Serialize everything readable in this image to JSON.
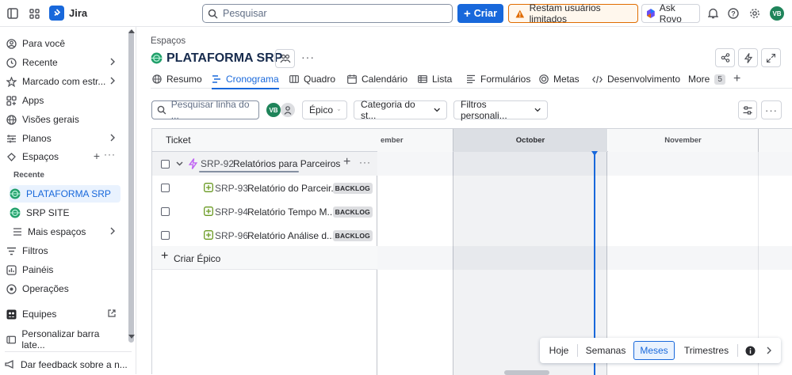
{
  "topbar": {
    "app_name": "Jira",
    "search_placeholder": "Pesquisar",
    "create_label": "Criar",
    "warning_label": "Restam usuários limitados",
    "rovo_label": "Ask Rovo",
    "avatar_initials": "VB"
  },
  "sidebar": {
    "items": [
      {
        "label": "Para você"
      },
      {
        "label": "Recente"
      },
      {
        "label": "Marcado com estr..."
      },
      {
        "label": "Apps"
      },
      {
        "label": "Visões gerais"
      },
      {
        "label": "Planos"
      },
      {
        "label": "Espaços"
      }
    ],
    "recent_heading": "Recente",
    "spaces": [
      {
        "label": "PLATAFORMA SRP"
      },
      {
        "label": "SRP SITE"
      },
      {
        "label": "Mais espaços"
      }
    ],
    "bottom_items": [
      {
        "label": "Filtros"
      },
      {
        "label": "Painéis"
      },
      {
        "label": "Operações"
      },
      {
        "label": "Equipes"
      },
      {
        "label": "Personalizar barra late..."
      },
      {
        "label": "Dar feedback sobre a n..."
      }
    ]
  },
  "header": {
    "breadcrumb": "Espaços",
    "title": "PLATAFORMA SRP"
  },
  "tabs": [
    {
      "label": "Resumo"
    },
    {
      "label": "Cronograma"
    },
    {
      "label": "Quadro"
    },
    {
      "label": "Calendário"
    },
    {
      "label": "Lista"
    },
    {
      "label": "Formulários"
    },
    {
      "label": "Metas"
    },
    {
      "label": "Desenvolvimento"
    },
    {
      "label": "More"
    }
  ],
  "more_count": "5",
  "toolbar": {
    "search_placeholder": "Pesquisar linha do ...",
    "avatar_initials": "VB",
    "epic_filter": "Épico",
    "category_filter": "Categoria do st...",
    "custom_filter": "Filtros personali..."
  },
  "timeline": {
    "column_header": "Ticket",
    "months": [
      "ember",
      "October",
      "November"
    ],
    "epic": {
      "key": "SRP-92",
      "summary": "Relatórios para Parceiros"
    },
    "children": [
      {
        "key": "SRP-93",
        "summary": "Relatório do Parceir...",
        "status": "BACKLOG"
      },
      {
        "key": "SRP-94",
        "summary": "Relatório Tempo M...",
        "status": "BACKLOG"
      },
      {
        "key": "SRP-96",
        "summary": "Relatório Análise d...",
        "status": "BACKLOG"
      }
    ],
    "create_epic_label": "Criar Épico"
  },
  "zoom": {
    "today": "Hoje",
    "weeks": "Semanas",
    "months": "Meses",
    "quarters": "Trimestres"
  },
  "colors": {
    "accent": "#1868db",
    "avatar": "#1f845a",
    "epic": "#bf63f3",
    "story": "#6a9a23",
    "warning_border": "#e06c00"
  }
}
